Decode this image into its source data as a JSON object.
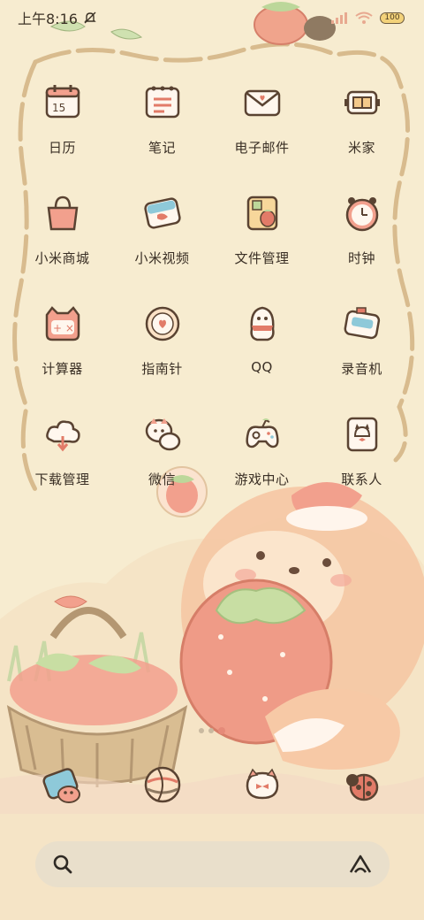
{
  "status_bar": {
    "time": "上午8:16",
    "battery": "100",
    "icons": [
      "mute-icon",
      "signal-icon",
      "wifi-icon",
      "battery-icon"
    ]
  },
  "apps": [
    {
      "label": "日历",
      "icon": "calendar-icon"
    },
    {
      "label": "笔记",
      "icon": "notes-icon"
    },
    {
      "label": "电子邮件",
      "icon": "email-icon"
    },
    {
      "label": "米家",
      "icon": "mijia-icon"
    },
    {
      "label": "小米商城",
      "icon": "shopping-bag-icon"
    },
    {
      "label": "小米视频",
      "icon": "video-icon"
    },
    {
      "label": "文件管理",
      "icon": "folder-icon"
    },
    {
      "label": "时钟",
      "icon": "clock-icon"
    },
    {
      "label": "计算器",
      "icon": "calculator-icon"
    },
    {
      "label": "指南针",
      "icon": "compass-icon"
    },
    {
      "label": "QQ",
      "icon": "qq-icon"
    },
    {
      "label": "录音机",
      "icon": "recorder-icon"
    },
    {
      "label": "下载管理",
      "icon": "download-icon"
    },
    {
      "label": "微信",
      "icon": "wechat-icon"
    },
    {
      "label": "游戏中心",
      "icon": "gamepad-icon"
    },
    {
      "label": "联系人",
      "icon": "contacts-icon"
    }
  ],
  "dock": [
    {
      "icon": "camera-icon"
    },
    {
      "icon": "browser-icon"
    },
    {
      "icon": "messages-icon"
    },
    {
      "icon": "ladybug-icon"
    }
  ],
  "page_indicator": {
    "pages": 3,
    "active": 2
  },
  "search": {
    "left_icon": "search-icon",
    "right_icon": "assistant-icon"
  },
  "colors": {
    "background": "#f7ecd0",
    "accent": "#e58a79",
    "text": "#3a2f25"
  }
}
